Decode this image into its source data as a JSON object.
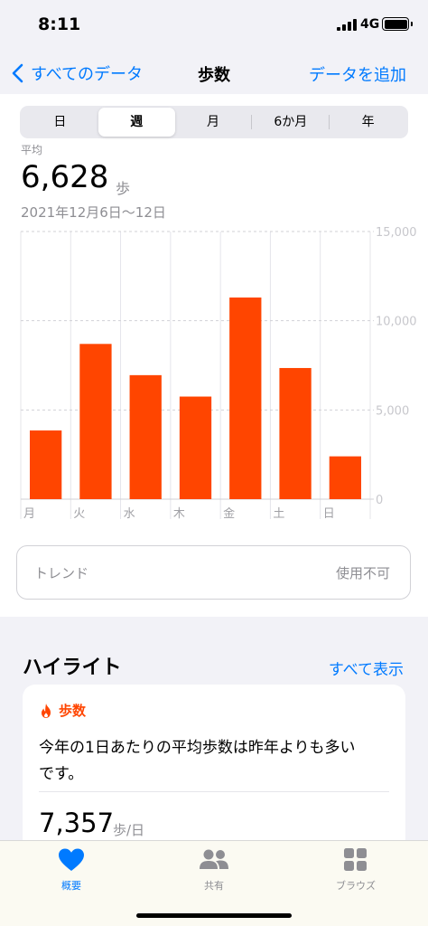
{
  "status": {
    "time": "8:11",
    "network": "4G"
  },
  "nav": {
    "back_label": "すべてのデータ",
    "title": "歩数",
    "action_label": "データを追加"
  },
  "segments": [
    {
      "label": "日",
      "selected": false
    },
    {
      "label": "週",
      "selected": true
    },
    {
      "label": "月",
      "selected": false
    },
    {
      "label": "6か月",
      "selected": false
    },
    {
      "label": "年",
      "selected": false
    }
  ],
  "summary": {
    "label": "平均",
    "value": "6,628",
    "unit": "歩",
    "date_range": "2021年12月6日〜12日"
  },
  "chart_data": {
    "type": "bar",
    "categories": [
      "月",
      "火",
      "水",
      "木",
      "金",
      "土",
      "日"
    ],
    "values": [
      3850,
      8700,
      6950,
      5750,
      11300,
      7350,
      2400
    ],
    "ylim": [
      0,
      15000
    ],
    "yticks": [
      "15,000",
      "10,000",
      "5,000",
      "0"
    ],
    "bar_color": "#ff4500",
    "grid": true
  },
  "trend": {
    "label": "トレンド",
    "value": "使用不可"
  },
  "highlights": {
    "title": "ハイライト",
    "link_label": "すべて表示",
    "card": {
      "category": "歩数",
      "text": "今年の1日あたりの平均歩数は昨年よりも多いです。",
      "value": "7,357",
      "unit": "歩/日"
    }
  },
  "tabs": [
    {
      "label": "概要",
      "icon": "heart-icon",
      "active": true
    },
    {
      "label": "共有",
      "icon": "people-icon",
      "active": false
    },
    {
      "label": "ブラウズ",
      "icon": "grid-icon",
      "active": false
    }
  ],
  "colors": {
    "accent": "#007aff",
    "steps": "#ff4500",
    "tab_inactive": "#8e8e93"
  }
}
